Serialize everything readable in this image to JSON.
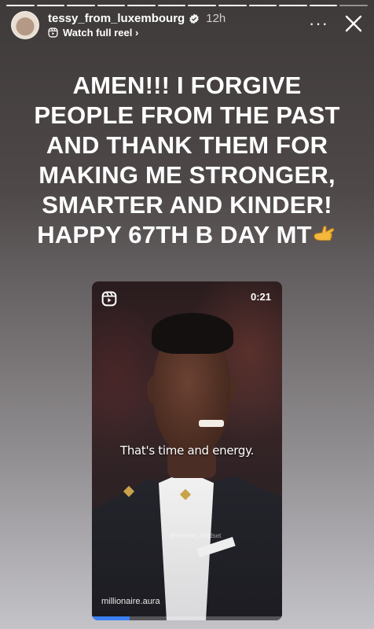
{
  "story": {
    "segments_total": 12,
    "segments_done": 11
  },
  "header": {
    "username": "tessy_from_luxembourg",
    "time_ago": "12h",
    "reel_link": "Watch full reel ›",
    "icons": [
      "avatar",
      "verified-badge-icon",
      "reel-icon",
      "more-icon",
      "close-icon"
    ]
  },
  "caption": {
    "lines": [
      "AMEN!!! I FORGIVE",
      "PEOPLE FROM THE PAST",
      "AND THANK THEM FOR",
      "MAKING ME STRONGER,",
      "SMARTER AND KINDER!",
      "HAPPY 67TH B DAY MT"
    ],
    "emoji": "call-me-hand-icon"
  },
  "reel": {
    "duration": "0:21",
    "subtitle": "That's time and energy.",
    "watermark": "@income_mindset",
    "source_handle": "millionaire.aura",
    "progress": 0.2
  },
  "colors": {
    "verified": "#3897f0",
    "progress_fill": "#3b82f6"
  }
}
